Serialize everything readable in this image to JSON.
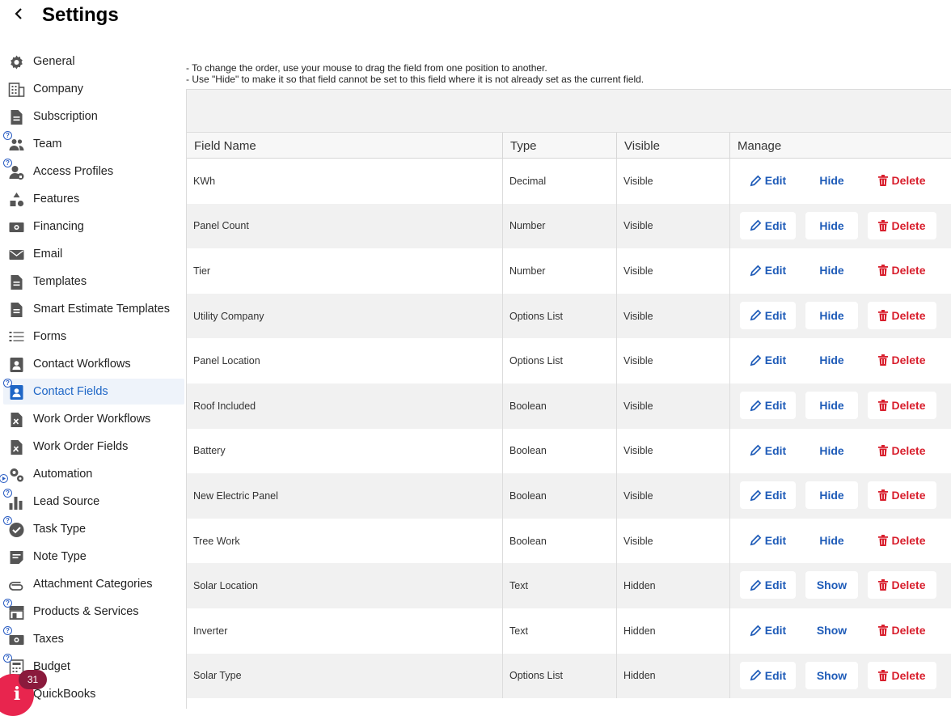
{
  "header": {
    "title": "Settings"
  },
  "sidebar": {
    "items": [
      {
        "label": "General",
        "icon": "gear-icon",
        "help": false
      },
      {
        "label": "Company",
        "icon": "building-icon",
        "help": false
      },
      {
        "label": "Subscription",
        "icon": "document-icon",
        "help": false
      },
      {
        "label": "Team",
        "icon": "people-icon",
        "help": true
      },
      {
        "label": "Access Profiles",
        "icon": "user-lock-icon",
        "help": true
      },
      {
        "label": "Features",
        "icon": "shapes-icon",
        "help": false
      },
      {
        "label": "Financing",
        "icon": "money-icon",
        "help": false
      },
      {
        "label": "Email",
        "icon": "envelope-icon",
        "help": false
      },
      {
        "label": "Templates",
        "icon": "document-icon",
        "help": false
      },
      {
        "label": "Smart Estimate Templates",
        "icon": "document-icon",
        "help": false
      },
      {
        "label": "Forms",
        "icon": "list-icon",
        "help": false
      },
      {
        "label": "Contact Workflows",
        "icon": "contact-card-icon",
        "help": false
      },
      {
        "label": "Contact Fields",
        "icon": "contact-card-icon",
        "help": true,
        "active": true
      },
      {
        "label": "Work Order Workflows",
        "icon": "tools-doc-icon",
        "help": false
      },
      {
        "label": "Work Order Fields",
        "icon": "tools-doc-icon",
        "help": false
      },
      {
        "label": "Automation",
        "icon": "gears-icon",
        "help": false,
        "play": true
      },
      {
        "label": "Lead Source",
        "icon": "bar-chart-icon",
        "help": true
      },
      {
        "label": "Task Type",
        "icon": "check-circle-icon",
        "help": true
      },
      {
        "label": "Note Type",
        "icon": "note-icon",
        "help": false
      },
      {
        "label": "Attachment Categories",
        "icon": "paperclip-icon",
        "help": false
      },
      {
        "label": "Products & Services",
        "icon": "store-icon",
        "help": true
      },
      {
        "label": "Taxes",
        "icon": "money-icon",
        "help": true
      },
      {
        "label": "Budget",
        "icon": "calculator-icon",
        "help": true
      },
      {
        "label": "QuickBooks",
        "icon": "quickbooks-icon",
        "help": false
      }
    ]
  },
  "notes": {
    "line1": "- To change the order, use your mouse to drag the field from one position to another.",
    "line2": "- Use \"Hide\" to make it so that field cannot be set to this field where it is not already set as the current field."
  },
  "table": {
    "columns": [
      "Field Name",
      "Type",
      "Visible",
      "Manage"
    ],
    "buttons": {
      "edit": "Edit",
      "delete": "Delete"
    },
    "rows": [
      {
        "name": "KWh",
        "type": "Decimal",
        "visible": "Visible",
        "toggle": "Hide"
      },
      {
        "name": "Panel Count",
        "type": "Number",
        "visible": "Visible",
        "toggle": "Hide"
      },
      {
        "name": "Tier",
        "type": "Number",
        "visible": "Visible",
        "toggle": "Hide"
      },
      {
        "name": "Utility Company",
        "type": "Options List",
        "visible": "Visible",
        "toggle": "Hide"
      },
      {
        "name": "Panel Location",
        "type": "Options List",
        "visible": "Visible",
        "toggle": "Hide"
      },
      {
        "name": "Roof Included",
        "type": "Boolean",
        "visible": "Visible",
        "toggle": "Hide"
      },
      {
        "name": "Battery",
        "type": "Boolean",
        "visible": "Visible",
        "toggle": "Hide"
      },
      {
        "name": "New Electric Panel",
        "type": "Boolean",
        "visible": "Visible",
        "toggle": "Hide"
      },
      {
        "name": "Tree Work",
        "type": "Boolean",
        "visible": "Visible",
        "toggle": "Hide"
      },
      {
        "name": "Solar Location",
        "type": "Text",
        "visible": "Hidden",
        "toggle": "Show"
      },
      {
        "name": "Inverter",
        "type": "Text",
        "visible": "Hidden",
        "toggle": "Show"
      },
      {
        "name": "Solar Type",
        "type": "Options List",
        "visible": "Hidden",
        "toggle": "Show"
      }
    ]
  },
  "notification": {
    "count": "31",
    "icon": "info-icon"
  },
  "colors": {
    "accent": "#1e5bb8",
    "danger": "#d81e2c",
    "badge": "#e8254e"
  }
}
